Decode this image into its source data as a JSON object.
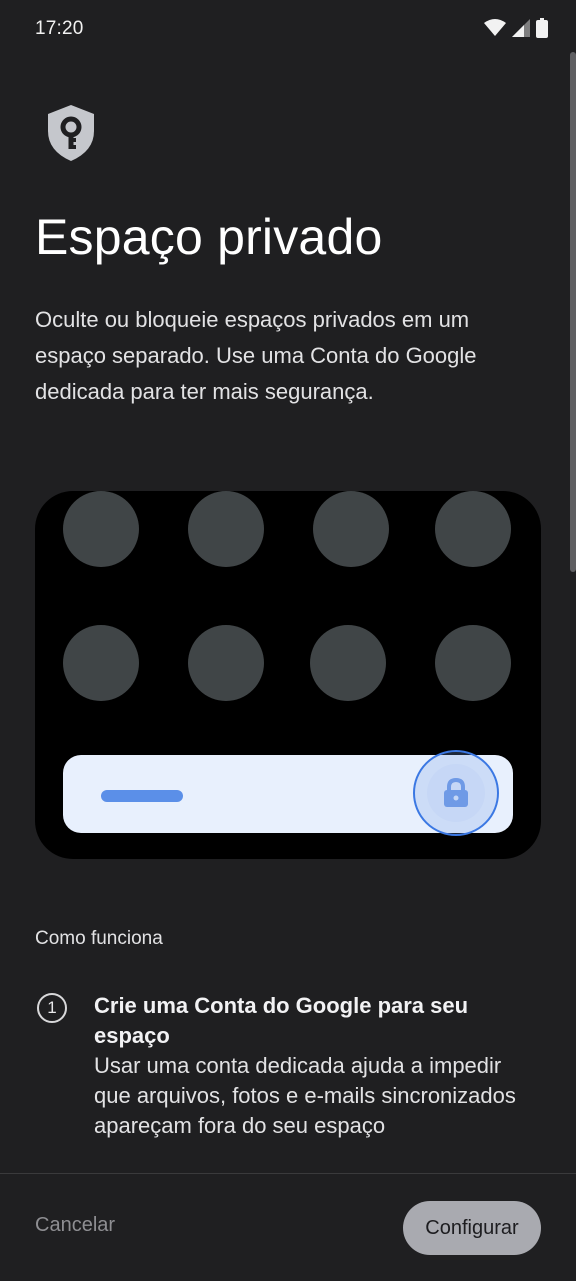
{
  "status_bar": {
    "time": "17:20",
    "icons": [
      "wifi-icon",
      "signal-icon",
      "battery-icon"
    ]
  },
  "header": {
    "icon": "shield-key-icon",
    "title": "Espaço privado",
    "description": "Oculte ou bloqueie espaços privados em um espaço separado. Use uma Conta do Google dedicada para ter mais segurança."
  },
  "illustration": {
    "icons": [
      "app-placeholder-icon",
      "lock-icon"
    ]
  },
  "how_it_works": {
    "label": "Como funciona",
    "steps": [
      {
        "number": "1",
        "title": "Crie uma Conta do Google para seu espaço",
        "body": "Usar uma conta dedicada ajuda a impedir que arquivos, fotos e e-mails sincronizados apareçam fora do seu espaço"
      }
    ]
  },
  "footer": {
    "cancel_label": "Cancelar",
    "configure_label": "Configurar"
  },
  "colors": {
    "background": "#1f1f21",
    "accent": "#3b78e3",
    "button_bg": "#a9aab0"
  }
}
